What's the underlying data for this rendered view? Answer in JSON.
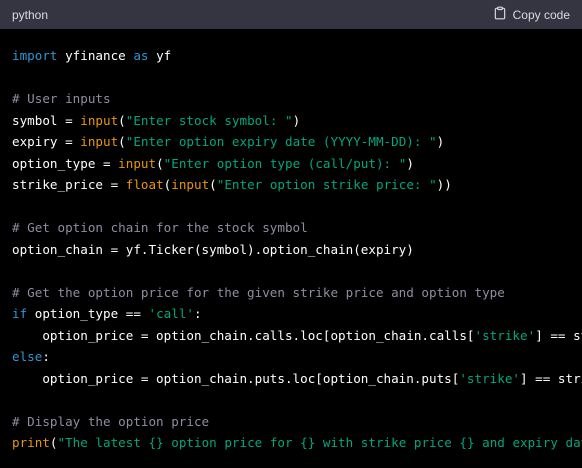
{
  "header": {
    "language": "python",
    "copy_label": "Copy code"
  },
  "code": [
    [
      [
        "kw",
        "import"
      ],
      [
        "p",
        " yfinance "
      ],
      [
        "kw",
        "as"
      ],
      [
        "p",
        " yf"
      ]
    ],
    [],
    [
      [
        "cm",
        "# User inputs"
      ]
    ],
    [
      [
        "p",
        "symbol = "
      ],
      [
        "fn",
        "input"
      ],
      [
        "p",
        "("
      ],
      [
        "str",
        "\"Enter stock symbol: \""
      ],
      [
        "p",
        ")"
      ]
    ],
    [
      [
        "p",
        "expiry = "
      ],
      [
        "fn",
        "input"
      ],
      [
        "p",
        "("
      ],
      [
        "str",
        "\"Enter option expiry date (YYYY-MM-DD): \""
      ],
      [
        "p",
        ")"
      ]
    ],
    [
      [
        "p",
        "option_type = "
      ],
      [
        "fn",
        "input"
      ],
      [
        "p",
        "("
      ],
      [
        "str",
        "\"Enter option type (call/put): \""
      ],
      [
        "p",
        ")"
      ]
    ],
    [
      [
        "p",
        "strike_price = "
      ],
      [
        "fn",
        "float"
      ],
      [
        "p",
        "("
      ],
      [
        "fn",
        "input"
      ],
      [
        "p",
        "("
      ],
      [
        "str",
        "\"Enter option strike price: \""
      ],
      [
        "p",
        "))"
      ]
    ],
    [],
    [
      [
        "cm",
        "# Get option chain for the stock symbol"
      ]
    ],
    [
      [
        "p",
        "option_chain = yf.Ticker(symbol).option_chain(expiry)"
      ]
    ],
    [],
    [
      [
        "cm",
        "# Get the option price for the given strike price and option type"
      ]
    ],
    [
      [
        "kw",
        "if"
      ],
      [
        "p",
        " option_type == "
      ],
      [
        "str",
        "'call'"
      ],
      [
        "p",
        ":"
      ]
    ],
    [
      [
        "p",
        "    option_price = option_chain.calls.loc[option_chain.calls["
      ],
      [
        "str",
        "'strike'"
      ],
      [
        "p",
        "] == strike_price"
      ]
    ],
    [
      [
        "kw",
        "else"
      ],
      [
        "p",
        ":"
      ]
    ],
    [
      [
        "p",
        "    option_price = option_chain.puts.loc[option_chain.puts["
      ],
      [
        "str",
        "'strike'"
      ],
      [
        "p",
        "] == strike_price"
      ]
    ],
    [],
    [
      [
        "cm",
        "# Display the option price"
      ]
    ],
    [
      [
        "fn",
        "print"
      ],
      [
        "p",
        "("
      ],
      [
        "str",
        "\"The latest {} option price for {} with strike price {} and expiry date {} is"
      ]
    ]
  ],
  "colors": {
    "keyword": "#2e95d3",
    "function": "#e9950c",
    "string": "#00a67d",
    "comment": "#8e8ea0",
    "plain": "#ffffff",
    "header_bg": "#343541",
    "code_bg": "#000000"
  },
  "icons": {
    "copy": "clipboard-icon"
  }
}
